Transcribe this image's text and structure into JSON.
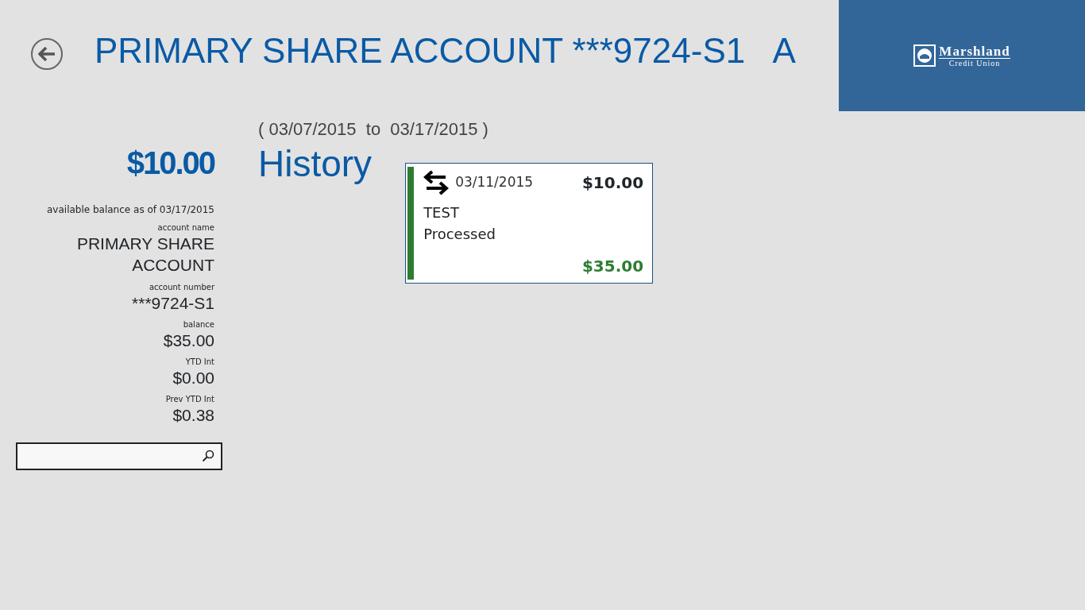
{
  "header": {
    "title": "PRIMARY SHARE ACCOUNT ***9724-S1   A",
    "logo": {
      "name": "Marshland",
      "subtitle": "Credit Union"
    }
  },
  "summary": {
    "amount": "$10.00",
    "caption": "available balance as of 03/17/2015",
    "details": [
      {
        "label": "account name",
        "value": "PRIMARY SHARE ACCOUNT"
      },
      {
        "label": "account number",
        "value": "***9724-S1"
      },
      {
        "label": "balance",
        "value": "$35.00"
      },
      {
        "label": "YTD Int",
        "value": "$0.00"
      },
      {
        "label": "Prev YTD Int",
        "value": "$0.38"
      }
    ]
  },
  "history": {
    "range": "( 03/07/2015  to  03/17/2015 )",
    "heading": "History",
    "transactions": [
      {
        "date": "03/11/2015",
        "amount": "$10.00",
        "description": "TEST",
        "status": "Processed",
        "balance": "$35.00"
      }
    ]
  }
}
